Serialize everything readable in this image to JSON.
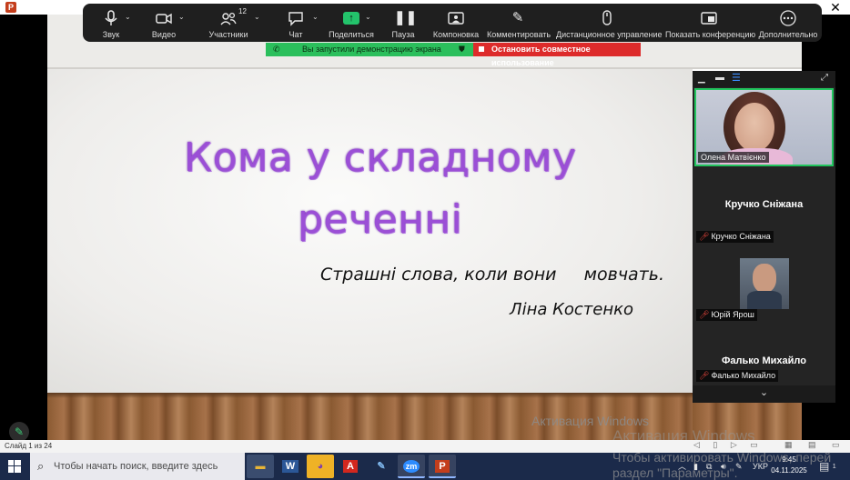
{
  "app": {
    "ppt_icon": "P"
  },
  "toolbar": {
    "items": [
      {
        "label": "Звук",
        "icon": "microphone-icon"
      },
      {
        "label": "Видео",
        "icon": "video-camera-icon"
      },
      {
        "label": "Участники",
        "icon": "participants-icon",
        "badge": "12"
      },
      {
        "label": "Чат",
        "icon": "chat-icon"
      },
      {
        "label": "Поделиться",
        "icon": "share-screen-icon"
      },
      {
        "label": "Пауза",
        "icon": "pause-icon"
      },
      {
        "label": "Компоновка",
        "icon": "layout-icon"
      },
      {
        "label": "Комментировать",
        "icon": "pencil-icon"
      },
      {
        "label": "Дистанционное управление",
        "icon": "mouse-icon"
      },
      {
        "label": "Показать конференцию",
        "icon": "show-meeting-icon"
      },
      {
        "label": "Дополнительно",
        "icon": "more-icon"
      }
    ],
    "close": "✕"
  },
  "share_banner": {
    "status": "Вы запустили демонстрацию экрана",
    "stop": "Остановить совместное использование"
  },
  "slide": {
    "title_line1": "Кома у складному",
    "title_line2": "реченні",
    "quote": "Страшні слова, коли вони     мовчать.",
    "author": "Ліна Костенко"
  },
  "participants": {
    "active_speaker": "Олена Матвієнко",
    "p2_big": "Кручко Сніжана",
    "p2_tag": "Кручко Сніжана",
    "p3_tag": "Юрій Ярош",
    "p4_big": "Фалько Михайло",
    "p4_tag": "Фалько Михайло"
  },
  "statusbar": {
    "slide_info": "Слайд 1 из 24"
  },
  "watermark": {
    "line1": "Активация Windows",
    "line2": "Активация Windows",
    "line3": "Чтобы активировать Windows, перей",
    "line4": "раздел \"Параметры\"."
  },
  "taskbar": {
    "search_placeholder": "Чтобы начать поиск, введите здесь запрос",
    "lang": "УКР",
    "time": "9:45",
    "date": "04.11.2025",
    "notif_count": "1",
    "apps": [
      {
        "name": "file-explorer",
        "glyph": "▬",
        "color": "#e8b536"
      },
      {
        "name": "word",
        "glyph": "W",
        "color": "#2b5797"
      },
      {
        "name": "viber",
        "glyph": "◕",
        "color": "#7d3daf"
      },
      {
        "name": "acrobat",
        "glyph": "A",
        "color": "#d2271e"
      },
      {
        "name": "paint",
        "glyph": "✎",
        "color": "#2f84c7"
      },
      {
        "name": "zoom",
        "glyph": "zm",
        "color": "#2d8cff"
      },
      {
        "name": "powerpoint",
        "glyph": "P",
        "color": "#c43e1c"
      }
    ]
  },
  "colors": {
    "accent_green": "#22c55e",
    "stop_red": "#dd2b2b",
    "title_purple": "#9b4fd6"
  }
}
